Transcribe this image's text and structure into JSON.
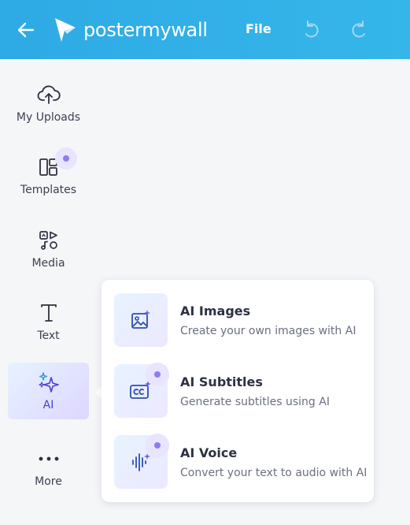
{
  "header": {
    "logo_text": "postermywall",
    "file_label": "File",
    "icons": {
      "back": "arrow-left-icon",
      "undo": "undo-icon",
      "redo": "redo-icon"
    }
  },
  "sidebar": {
    "items": [
      {
        "label": "My Uploads",
        "icon": "cloud-upload-icon",
        "badge": false,
        "active": false
      },
      {
        "label": "Templates",
        "icon": "templates-icon",
        "badge": true,
        "active": false
      },
      {
        "label": "Media",
        "icon": "media-icon",
        "badge": false,
        "active": false
      },
      {
        "label": "Text",
        "icon": "text-icon",
        "badge": false,
        "active": false
      },
      {
        "label": "AI",
        "icon": "sparkles-icon",
        "badge": false,
        "active": true
      },
      {
        "label": "More",
        "icon": "more-dots-icon",
        "badge": false,
        "active": false
      }
    ]
  },
  "ai_menu": {
    "options": [
      {
        "title": "AI Images",
        "description": "Create your own images with AI",
        "icon": "ai-image-icon",
        "badge": false
      },
      {
        "title": "AI Subtitles",
        "description": "Generate subtitles using AI",
        "icon": "ai-subtitles-icon",
        "badge": true
      },
      {
        "title": "AI Voice",
        "description": "Convert your text to audio with AI",
        "icon": "ai-voice-icon",
        "badge": true
      }
    ]
  },
  "colors": {
    "header": "#2eaae4",
    "accent": "#4b3fd6",
    "badge_dot": "#8f7cf0",
    "badge_bg": "#e9e4ff"
  }
}
